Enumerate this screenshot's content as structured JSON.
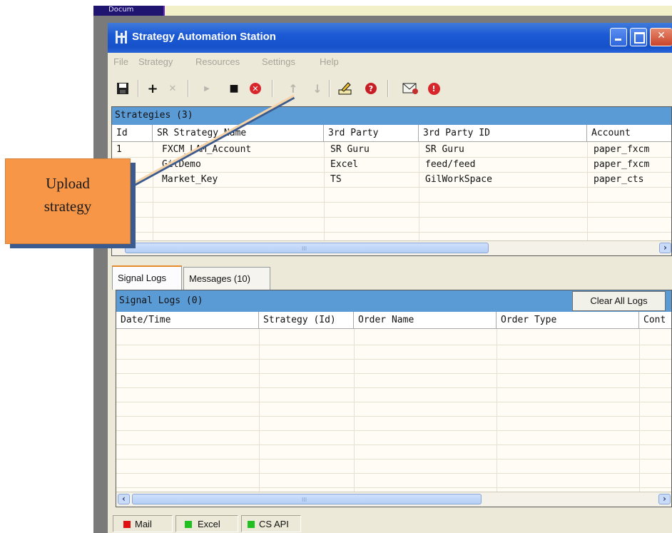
{
  "backdrop": {
    "corner_text": "Docum"
  },
  "window": {
    "title": "Strategy Automation Station",
    "title_bar_color": "#1c5ad6",
    "controls": {
      "minimize_icon": "minimize-icon",
      "maximize_icon": "maximize-icon",
      "close_glyph": "✕"
    }
  },
  "menu": [
    "File",
    "Strategy",
    "Resources",
    "Settings",
    "Help"
  ],
  "toolbar": {
    "icons": [
      "save-icon",
      "add-icon",
      "delete-icon",
      "start-icon",
      "stop-icon",
      "cancel-icon",
      "move-up-icon",
      "move-down-icon",
      "edit-icon",
      "help-icon",
      "mail-settings-icon",
      "alert-icon"
    ],
    "add_glyph": "+",
    "delete_glyph": "✕",
    "start_glyph": "▶",
    "stop_glyph": "■",
    "cancel_glyph": "✕",
    "up_glyph": "↑",
    "down_glyph": "↓",
    "help_glyph": "?",
    "alert_glyph": "!"
  },
  "strategies": {
    "header": "Strategies (3)",
    "columns": [
      "Id",
      "SR Strategy Name",
      "3rd Party",
      "3rd Party ID",
      "Account"
    ],
    "rows": [
      {
        "id": "1",
        "name": "FXCM_LAM_Account",
        "party": "SR Guru",
        "party_id": "SR Guru",
        "account": "paper_fxcm"
      },
      {
        "id": "",
        "name": "GilDemo",
        "party": "Excel",
        "party_id": "feed/feed",
        "account": "paper_fxcm"
      },
      {
        "id": "",
        "name": "Market_Key",
        "party": "TS",
        "party_id": "GilWorkSpace",
        "account": "paper_cts"
      }
    ],
    "scroll_grip": "III",
    "scroll_right": "›"
  },
  "tabs": [
    "Signal Logs",
    "Messages (10)"
  ],
  "signal_logs": {
    "header": "Signal Logs (0)",
    "clear_button": "Clear All Logs",
    "columns": [
      "Date/Time",
      "Strategy (Id)",
      "Order Name",
      "Order Type",
      "Cont"
    ],
    "scroll_grip": "III",
    "scroll_left": "‹",
    "scroll_right": "›"
  },
  "status": [
    {
      "label": "Mail",
      "color": "#e01010"
    },
    {
      "label": "Excel",
      "color": "#20c020"
    },
    {
      "label": "CS API",
      "color": "#20c020"
    }
  ],
  "callout": {
    "line1": "Upload",
    "line2": "strategy",
    "color": "#f79646"
  }
}
